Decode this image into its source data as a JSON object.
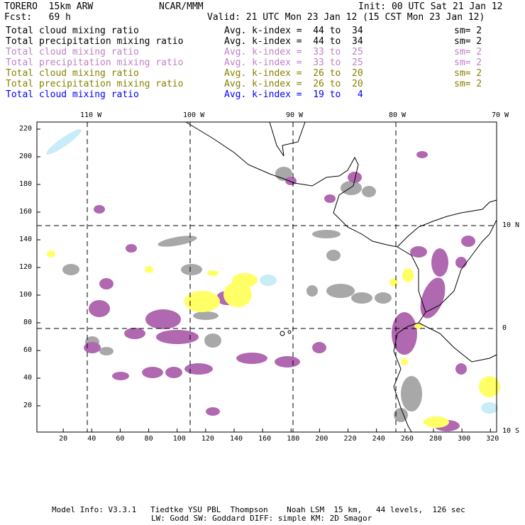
{
  "header": {
    "model": "TORERO  15km ARW",
    "org": "NCAR/MMM",
    "init": "Init: 00 UTC Sat 21 Jan 12",
    "fcst": "Fcst:   69 h",
    "valid": "Valid: 21 UTC Mon 23 Jan 12 (15 CST Mon 23 Jan 12)"
  },
  "legend": [
    {
      "field": "Total cloud mixing ratio",
      "range": "Avg. k-index =  44 to  34",
      "sm": "sm= 2",
      "color": "#000000"
    },
    {
      "field": "Total precipitation mixing ratio",
      "range": "Avg. k-index =  44 to  34",
      "sm": "sm= 2",
      "color": "#000000"
    },
    {
      "field": "Total cloud mixing ratio",
      "range": "Avg. k-index =  33 to  25",
      "sm": "sm= 2",
      "color": "#c080c8"
    },
    {
      "field": "Total precipitation mixing ratio",
      "range": "Avg. k-index =  33 to  25",
      "sm": "sm= 2",
      "color": "#c080c8"
    },
    {
      "field": "Total cloud mixing ratio",
      "range": "Avg. k-index =  26 to  20",
      "sm": "sm= 2",
      "color": "#888000"
    },
    {
      "field": "Total precipitation mixing ratio",
      "range": "Avg. k-index =  26 to  20",
      "sm": "sm= 2",
      "color": "#888000"
    },
    {
      "field": "Total cloud mixing ratio",
      "range": "Avg. k-index =  19 to   4",
      "sm": "",
      "color": "#0000ff"
    }
  ],
  "map": {
    "lon_labels": [
      "110 W",
      "100 W",
      "90 W",
      "80 W",
      "70 W"
    ],
    "lat_labels": [
      "10 N",
      "0",
      "10 S"
    ],
    "x_ticks": [
      "20",
      "40",
      "60",
      "80",
      "100",
      "120",
      "140",
      "160",
      "180",
      "200",
      "220",
      "240",
      "260",
      "280",
      "300",
      "320"
    ],
    "y_ticks": [
      "20",
      "40",
      "60",
      "80",
      "100",
      "120",
      "140",
      "160",
      "180",
      "200",
      "220"
    ],
    "colors": {
      "gray": "#a8a8a8",
      "purple": "#b068b0",
      "yellow": "#ffff66",
      "lightblue": "#c8ecf8"
    }
  },
  "footer": {
    "line1": "Model Info: V3.3.1   Tiedtke YSU PBL  Thompson    Noah LSM  15 km,   44 levels,  126 sec",
    "line2": "LW: Godd SW: Goddard DIFF: simple KM: 2D Smagor"
  }
}
